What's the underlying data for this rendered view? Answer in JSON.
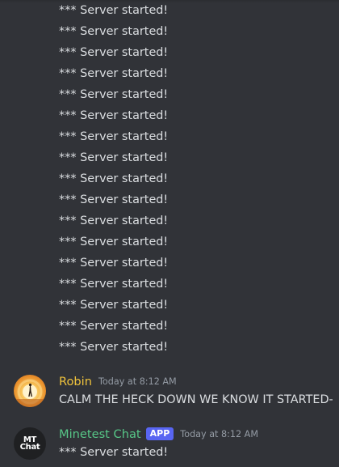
{
  "continuation_lines": [
    "*** Server started!",
    "*** Server started!",
    "*** Server started!",
    "*** Server started!",
    "*** Server started!",
    "*** Server started!",
    "*** Server started!",
    "*** Server started!",
    "*** Server started!",
    "*** Server started!",
    "*** Server started!",
    "*** Server started!",
    "*** Server started!",
    "*** Server started!",
    "*** Server started!",
    "*** Server started!",
    "*** Server started!"
  ],
  "messages": [
    {
      "author": "Robin",
      "timestamp": "Today at 8:12 AM",
      "text": "CALM THE HECK DOWN WE KNOW IT STARTED-",
      "avatar_icon": "silhouette-sunset-avatar",
      "name_color": "#f0c33c"
    },
    {
      "author": "Minetest Chat",
      "badge": "APP",
      "timestamp": "Today at 8:12 AM",
      "text": "*** Server started!",
      "avatar_text": "MT\nChat",
      "name_color": "#57c687"
    }
  ],
  "colors": {
    "background": "#313338",
    "text": "#dbdee1",
    "timestamp": "#949ba4",
    "badge": "#5865f2"
  }
}
